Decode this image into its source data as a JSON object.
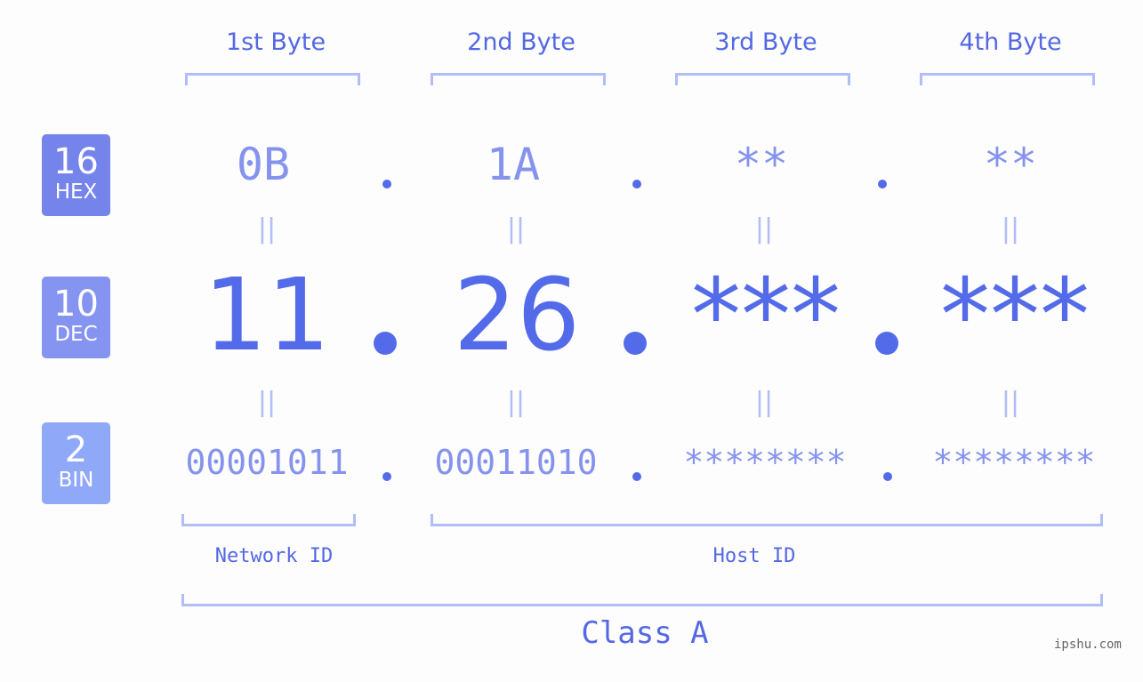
{
  "bytes": [
    {
      "header": "1st Byte",
      "hex": "0B",
      "dec": "11",
      "bin": "00001011"
    },
    {
      "header": "2nd Byte",
      "hex": "1A",
      "dec": "26",
      "bin": "00011010"
    },
    {
      "header": "3rd Byte",
      "hex": "**",
      "dec": "***",
      "bin": "********"
    },
    {
      "header": "4th Byte",
      "hex": "**",
      "dec": "***",
      "bin": "********"
    }
  ],
  "badges": {
    "hex": {
      "num": "16",
      "label": "HEX",
      "color": "#7584ea"
    },
    "dec": {
      "num": "10",
      "label": "DEC",
      "color": "#8594f0"
    },
    "bin": {
      "num": "2",
      "label": "BIN",
      "color": "#90a8f8"
    }
  },
  "equals_glyph": "||",
  "network_label": "Network ID",
  "host_label": "Host ID",
  "class_label": "Class A",
  "watermark": "ipshu.com",
  "colors": {
    "primary": "#546be9",
    "light": "#8693ee",
    "bracket": "#b0bdf6"
  }
}
